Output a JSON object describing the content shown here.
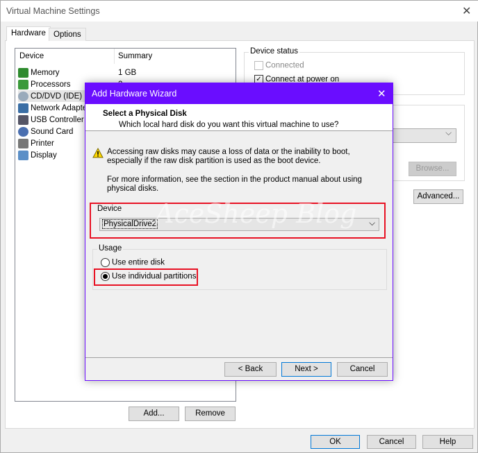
{
  "window": {
    "title": "Virtual Machine Settings",
    "close": "✕"
  },
  "tabs": [
    {
      "label": "Hardware",
      "active": true
    },
    {
      "label": "Options",
      "active": false
    }
  ],
  "device_list": {
    "headers": [
      "Device",
      "Summary"
    ],
    "items": [
      {
        "name": "Memory",
        "summary": "1 GB",
        "icon": "memory-icon"
      },
      {
        "name": "Processors",
        "summary": "2",
        "icon": "processor-icon"
      },
      {
        "name": "CD/DVD (IDE)",
        "summary": "",
        "icon": "cd-dvd-icon"
      },
      {
        "name": "Network Adapter",
        "summary": "",
        "icon": "network-adapter-icon"
      },
      {
        "name": "USB Controller",
        "summary": "",
        "icon": "usb-icon"
      },
      {
        "name": "Sound Card",
        "summary": "",
        "icon": "sound-card-icon"
      },
      {
        "name": "Printer",
        "summary": "",
        "icon": "printer-icon"
      },
      {
        "name": "Display",
        "summary": "",
        "icon": "display-icon"
      }
    ]
  },
  "list_buttons": {
    "add": "Add...",
    "remove": "Remove"
  },
  "device_status": {
    "label": "Device status",
    "connected": "Connected",
    "connect_power": "Connect at power on"
  },
  "right": {
    "browse": "Browse...",
    "advanced": "Advanced..."
  },
  "footer": {
    "ok": "OK",
    "cancel": "Cancel",
    "help": "Help"
  },
  "wizard": {
    "title": "Add Hardware Wizard",
    "close": "✕",
    "heading": "Select a Physical Disk",
    "subheading": "Which local hard disk do you want this virtual machine to use?",
    "warning": "Accessing raw disks may cause a loss of data or the inability to boot, especially if the raw disk partition is used as the boot device.",
    "info": "For more information, see the section in the product manual about using physical disks.",
    "device_label": "Device",
    "device_value": "PhysicalDrive2",
    "usage_label": "Usage",
    "use_entire": "Use entire disk",
    "use_partitions": "Use individual partitions",
    "selected_usage": "partitions",
    "back": "< Back",
    "next": "Next >",
    "cancel": "Cancel",
    "accent": "#6a0dff",
    "highlight": "#e81123"
  },
  "watermark": "AceSheep Blog"
}
